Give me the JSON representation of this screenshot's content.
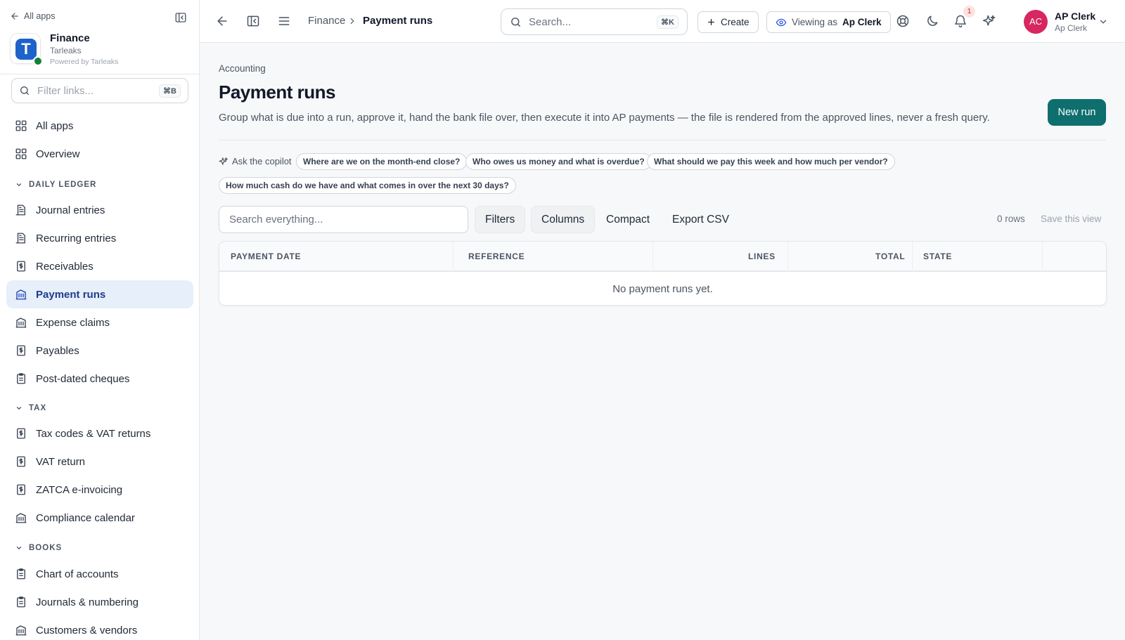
{
  "sidebar": {
    "back_label": "All apps",
    "org_name": "Finance",
    "org_subtitle": "Tarleaks",
    "org_powered": "Powered by Tarleaks",
    "logo_letter": "T",
    "filter_placeholder": "Filter links...",
    "filter_shortcut": "⌘B",
    "top_items": [
      {
        "label": "All apps",
        "icon": "grid-icon"
      },
      {
        "label": "Overview",
        "icon": "grid-icon"
      }
    ],
    "sections": [
      {
        "title": "DAILY LEDGER",
        "items": [
          {
            "label": "Journal entries",
            "icon": "ledger-icon"
          },
          {
            "label": "Recurring entries",
            "icon": "ledger-icon"
          },
          {
            "label": "Receivables",
            "icon": "dollar-doc-icon"
          },
          {
            "label": "Payment runs",
            "icon": "bank-icon",
            "active": true
          },
          {
            "label": "Expense claims",
            "icon": "bank-icon"
          },
          {
            "label": "Payables",
            "icon": "dollar-doc-icon"
          },
          {
            "label": "Post-dated cheques",
            "icon": "clipboard-icon"
          }
        ]
      },
      {
        "title": "TAX",
        "items": [
          {
            "label": "Tax codes & VAT returns",
            "icon": "dollar-doc-icon"
          },
          {
            "label": "VAT return",
            "icon": "dollar-doc-icon"
          },
          {
            "label": "ZATCA e-invoicing",
            "icon": "dollar-doc-icon"
          },
          {
            "label": "Compliance calendar",
            "icon": "bank-icon"
          }
        ]
      },
      {
        "title": "BOOKS",
        "items": [
          {
            "label": "Chart of accounts",
            "icon": "clipboard-icon"
          },
          {
            "label": "Journals & numbering",
            "icon": "clipboard-icon"
          },
          {
            "label": "Customers & vendors",
            "icon": "bank-icon"
          }
        ]
      }
    ]
  },
  "header": {
    "breadcrumb": [
      "Finance",
      "Payment runs"
    ],
    "search_placeholder": "Search...",
    "search_shortcut": "⌘K",
    "create_label": "Create",
    "viewing_as_label": "Viewing as",
    "viewing_as_role": "Ap Clerk",
    "notification_count": "1",
    "user_initials": "AC",
    "user_name": "AP Clerk",
    "user_role": "Ap Clerk"
  },
  "page": {
    "eyebrow": "Accounting",
    "title": "Payment runs",
    "description": "Group what is due into a run, approve it, hand the bank file over, then execute it into AP payments — the file is rendered from the approved lines, never a fresh query.",
    "primary_action": "New run",
    "copilot_label": "Ask the copilot",
    "suggestions": [
      "Where are we on the month-end close?",
      "Who owes us money and what is overdue?",
      "What should we pay this week and how much per vendor?",
      "How much cash do we have and what comes in over the next 30 days?"
    ]
  },
  "table": {
    "search_placeholder": "Search everything...",
    "toolbar": [
      "Filters",
      "Columns",
      "Compact",
      "Export CSV"
    ],
    "row_count": "0 rows",
    "save_view": "Save this view",
    "columns": [
      "PAYMENT DATE",
      "REFERENCE",
      "LINES",
      "TOTAL",
      "STATE"
    ],
    "empty_message": "No payment runs yet."
  },
  "colors": {
    "primary": "#0f6e6e",
    "active_nav_bg": "#e6effa",
    "avatar": "#d72660",
    "logo": "#1d63c9"
  }
}
